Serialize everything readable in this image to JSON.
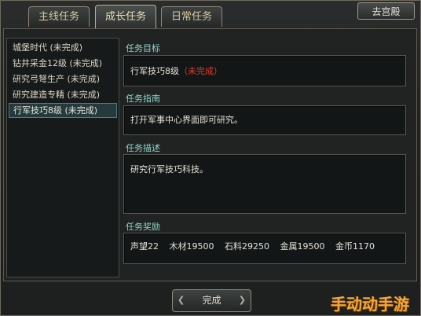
{
  "tabs": [
    {
      "label": "主线任务"
    },
    {
      "label": "成长任务"
    },
    {
      "label": "日常任务"
    }
  ],
  "top_button": "去宫殿",
  "quest_list": [
    "城堡时代 (未完成)",
    "钻井采金12级 (未完成)",
    "研究弓弩生产 (未完成)",
    "研究建造专精 (未完成)",
    "行军技巧8级 (未完成)"
  ],
  "selected_index": 4,
  "goal": {
    "title": "任务目标",
    "text": "行军技巧8级",
    "status": "（未完成）"
  },
  "guide": {
    "title": "任务指南",
    "text": "打开军事中心界面即可研究。"
  },
  "description": {
    "title": "任务描述",
    "text": "研究行军技巧科技。"
  },
  "rewards": {
    "title": "任务奖励",
    "items": [
      "声望22",
      "木材19500",
      "石料29250",
      "金属19500",
      "金币1170"
    ]
  },
  "complete_button": "完成",
  "watermark": "手动动手游"
}
